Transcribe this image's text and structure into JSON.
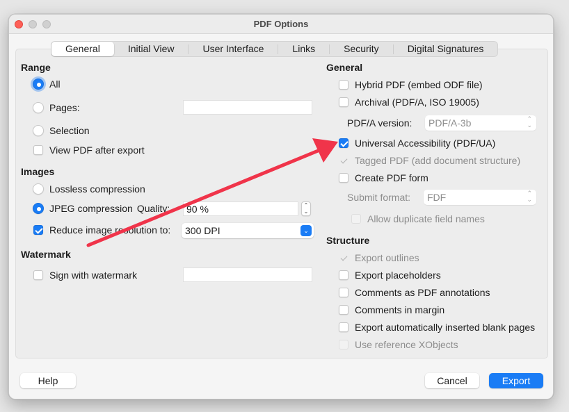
{
  "window": {
    "title": "PDF Options"
  },
  "tabs": [
    {
      "label": "General",
      "active": true
    },
    {
      "label": "Initial View",
      "active": false
    },
    {
      "label": "User Interface",
      "active": false
    },
    {
      "label": "Links",
      "active": false
    },
    {
      "label": "Security",
      "active": false
    },
    {
      "label": "Digital Signatures",
      "active": false
    }
  ],
  "range": {
    "title": "Range",
    "all_label": "All",
    "all_checked": true,
    "pages_label": "Pages:",
    "pages_value": "",
    "selection_label": "Selection",
    "view_after_export_label": "View PDF after export",
    "view_after_export_checked": false
  },
  "images": {
    "title": "Images",
    "lossless_label": "Lossless compression",
    "jpeg_label": "JPEG compression",
    "jpeg_checked": true,
    "quality_label": "Quality:",
    "quality_value": "90 %",
    "reduce_label": "Reduce image resolution to:",
    "reduce_checked": true,
    "resolution_value": "300 DPI"
  },
  "watermark": {
    "title": "Watermark",
    "sign_label": "Sign with watermark",
    "sign_checked": false,
    "text_value": ""
  },
  "general": {
    "title": "General",
    "hybrid_label": "Hybrid PDF (embed ODF file)",
    "archival_label": "Archival (PDF/A, ISO 19005)",
    "pdfa_version_label": "PDF/A version:",
    "pdfa_version_value": "PDF/A-3b",
    "ua_label": "Universal Accessibility (PDF/UA)",
    "ua_checked": true,
    "tagged_label": "Tagged PDF (add document structure)",
    "tagged_checked": true,
    "form_label": "Create PDF form",
    "submit_format_label": "Submit format:",
    "submit_format_value": "FDF",
    "duplicate_label": "Allow duplicate field names"
  },
  "structure": {
    "title": "Structure",
    "outlines_label": "Export outlines",
    "outlines_checked": true,
    "placeholders_label": "Export placeholders",
    "comments_pdf_label": "Comments as PDF annotations",
    "comments_margin_label": "Comments in margin",
    "blank_pages_label": "Export automatically inserted blank pages",
    "xobjects_label": "Use reference XObjects"
  },
  "footer": {
    "help_label": "Help",
    "cancel_label": "Cancel",
    "export_label": "Export"
  },
  "annotation": {
    "arrow_color": "#f0344a",
    "points_to": "Universal Accessibility (PDF/UA)"
  },
  "icons": {
    "spin_up": "⌃",
    "spin_down": "⌄",
    "chevron_down": "⌄",
    "updown": "⇕"
  }
}
